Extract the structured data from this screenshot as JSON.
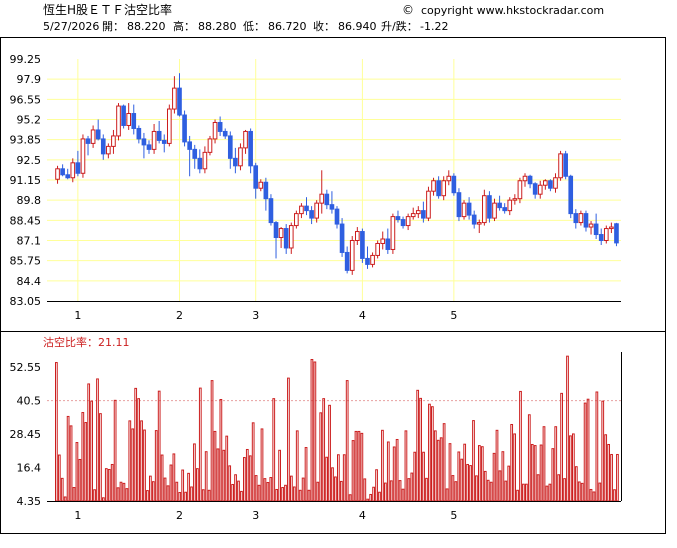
{
  "header": {
    "title": "恆生H股ＥＴＦ沽空比率",
    "copyright": "copyright www.hkstockradar.com",
    "date": "5/27/2026",
    "open_label": "開：",
    "open": "88.220",
    "high_label": "高：",
    "high": "88.280",
    "low_label": "低：",
    "low": "86.720",
    "close_label": "收：",
    "close": "86.940",
    "change_label": "升/跌：",
    "change": "-1.22"
  },
  "colors": {
    "up": "#cc1e1e",
    "down": "#2f5fe0",
    "grid": "#ffff99",
    "bar_stroke": "#cc1e1e",
    "ref_line": "#e8a0a0",
    "label_red": "#cc1e1e"
  },
  "chart_data": [
    {
      "type": "candlestick",
      "title": "",
      "xlabel": "",
      "ylabel": "",
      "ylim": [
        83.05,
        99.25
      ],
      "y_ticks": [
        "99.25",
        "97.9",
        "96.55",
        "95.2",
        "93.85",
        "92.5",
        "91.15",
        "89.8",
        "88.45",
        "87.1",
        "85.75",
        "84.4",
        "83.05"
      ],
      "x_ticks": [
        {
          "label": "1",
          "index": 4
        },
        {
          "label": "2",
          "index": 24
        },
        {
          "label": "3",
          "index": 39
        },
        {
          "label": "4",
          "index": 60
        },
        {
          "label": "5",
          "index": 78
        }
      ],
      "ohlc": [
        [
          91.2,
          92.1,
          90.9,
          91.9
        ],
        [
          91.9,
          92.2,
          91.4,
          91.5
        ],
        [
          91.5,
          91.9,
          91.2,
          91.3
        ],
        [
          91.3,
          92.6,
          91.0,
          92.3
        ],
        [
          92.3,
          93.1,
          91.4,
          91.6
        ],
        [
          91.6,
          94.2,
          91.3,
          93.9
        ],
        [
          93.9,
          94.1,
          92.8,
          93.6
        ],
        [
          93.6,
          94.8,
          93.3,
          94.5
        ],
        [
          94.5,
          95.2,
          93.8,
          93.9
        ],
        [
          93.9,
          94.2,
          92.5,
          92.9
        ],
        [
          92.9,
          93.6,
          92.6,
          93.4
        ],
        [
          93.4,
          94.5,
          92.9,
          94.1
        ],
        [
          94.1,
          96.3,
          93.8,
          96.1
        ],
        [
          96.1,
          96.2,
          94.6,
          94.8
        ],
        [
          94.8,
          96.3,
          94.5,
          95.6
        ],
        [
          95.6,
          96.2,
          94.2,
          94.6
        ],
        [
          94.6,
          94.8,
          93.6,
          93.9
        ],
        [
          93.9,
          94.3,
          92.6,
          93.5
        ],
        [
          93.5,
          93.8,
          92.9,
          93.2
        ],
        [
          93.2,
          94.9,
          92.9,
          94.4
        ],
        [
          94.4,
          95.1,
          93.6,
          93.8
        ],
        [
          93.8,
          94.2,
          93.0,
          93.6
        ],
        [
          93.6,
          96.2,
          93.4,
          95.9
        ],
        [
          95.9,
          98.1,
          95.6,
          97.3
        ],
        [
          97.3,
          98.3,
          95.4,
          95.5
        ],
        [
          95.5,
          95.8,
          93.4,
          93.7
        ],
        [
          93.7,
          94.1,
          91.4,
          93.2
        ],
        [
          93.2,
          93.5,
          91.9,
          92.6
        ],
        [
          92.6,
          93.2,
          91.6,
          91.9
        ],
        [
          91.9,
          93.4,
          91.6,
          93.0
        ],
        [
          93.0,
          94.1,
          92.8,
          93.9
        ],
        [
          93.9,
          95.2,
          93.6,
          95.0
        ],
        [
          95.0,
          95.4,
          94.1,
          94.4
        ],
        [
          94.4,
          94.6,
          93.9,
          94.1
        ],
        [
          94.1,
          94.4,
          91.9,
          92.6
        ],
        [
          92.6,
          93.3,
          91.6,
          92.1
        ],
        [
          92.1,
          93.6,
          91.8,
          93.3
        ],
        [
          93.3,
          94.5,
          92.9,
          94.4
        ],
        [
          94.4,
          94.6,
          91.6,
          92.1
        ],
        [
          92.1,
          92.3,
          89.9,
          90.6
        ],
        [
          90.6,
          91.2,
          90.4,
          91.0
        ],
        [
          91.0,
          91.3,
          89.1,
          89.9
        ],
        [
          89.9,
          90.2,
          88.1,
          88.3
        ],
        [
          88.3,
          88.4,
          85.9,
          87.3
        ],
        [
          87.3,
          88.0,
          86.6,
          87.9
        ],
        [
          87.9,
          88.2,
          86.2,
          86.6
        ],
        [
          86.6,
          88.3,
          86.2,
          88.1
        ],
        [
          88.1,
          89.1,
          87.9,
          88.9
        ],
        [
          88.9,
          89.6,
          88.6,
          89.4
        ],
        [
          89.4,
          90.0,
          88.8,
          89.1
        ],
        [
          89.1,
          89.4,
          88.2,
          88.6
        ],
        [
          88.6,
          89.8,
          88.3,
          89.6
        ],
        [
          89.6,
          91.8,
          88.9,
          90.2
        ],
        [
          90.2,
          90.5,
          89.2,
          89.5
        ],
        [
          89.5,
          90.4,
          88.9,
          89.2
        ],
        [
          89.2,
          89.4,
          87.9,
          88.2
        ],
        [
          88.2,
          88.6,
          86.0,
          86.3
        ],
        [
          86.3,
          86.7,
          84.9,
          85.1
        ],
        [
          85.1,
          87.4,
          84.8,
          87.1
        ],
        [
          87.1,
          88.0,
          86.8,
          87.7
        ],
        [
          87.7,
          87.9,
          85.6,
          85.9
        ],
        [
          85.9,
          86.7,
          85.2,
          85.5
        ],
        [
          85.5,
          86.3,
          85.3,
          86.1
        ],
        [
          86.1,
          87.1,
          85.9,
          86.9
        ],
        [
          86.9,
          87.7,
          86.5,
          87.2
        ],
        [
          87.2,
          87.9,
          86.2,
          86.5
        ],
        [
          86.5,
          88.9,
          86.2,
          88.7
        ],
        [
          88.7,
          89.1,
          88.3,
          88.5
        ],
        [
          88.5,
          88.7,
          87.9,
          88.1
        ],
        [
          88.1,
          88.9,
          87.8,
          88.7
        ],
        [
          88.7,
          89.3,
          88.5,
          88.9
        ],
        [
          88.9,
          89.4,
          88.6,
          89.1
        ],
        [
          89.1,
          89.7,
          88.3,
          88.6
        ],
        [
          88.6,
          90.7,
          88.4,
          90.4
        ],
        [
          90.4,
          91.3,
          90.1,
          91.1
        ],
        [
          91.1,
          91.4,
          89.9,
          90.1
        ],
        [
          90.1,
          91.4,
          89.8,
          91.1
        ],
        [
          91.1,
          91.8,
          90.8,
          91.4
        ],
        [
          91.4,
          91.6,
          90.1,
          90.3
        ],
        [
          90.3,
          90.6,
          88.4,
          88.7
        ],
        [
          88.7,
          89.8,
          88.5,
          89.6
        ],
        [
          89.6,
          90.0,
          88.5,
          88.8
        ],
        [
          88.8,
          89.1,
          87.9,
          88.2
        ],
        [
          88.2,
          88.5,
          87.6,
          88.3
        ],
        [
          88.3,
          90.5,
          88.1,
          90.1
        ],
        [
          90.1,
          90.4,
          88.3,
          88.6
        ],
        [
          88.6,
          89.9,
          88.4,
          89.6
        ],
        [
          89.6,
          90.1,
          89.1,
          89.3
        ],
        [
          89.3,
          89.6,
          88.9,
          89.1
        ],
        [
          89.1,
          90.0,
          88.8,
          89.8
        ],
        [
          89.8,
          90.2,
          89.5,
          89.9
        ],
        [
          89.9,
          91.3,
          89.6,
          91.1
        ],
        [
          91.1,
          91.6,
          90.7,
          91.4
        ],
        [
          91.4,
          91.5,
          90.6,
          90.9
        ],
        [
          90.9,
          91.0,
          89.9,
          90.2
        ],
        [
          90.2,
          91.1,
          89.9,
          90.8
        ],
        [
          90.8,
          91.2,
          90.5,
          91.1
        ],
        [
          91.1,
          91.2,
          90.4,
          90.6
        ],
        [
          90.6,
          91.6,
          90.3,
          91.3
        ],
        [
          91.3,
          93.1,
          91.1,
          92.9
        ],
        [
          92.9,
          93.1,
          91.2,
          91.4
        ],
        [
          91.4,
          91.5,
          88.6,
          88.9
        ],
        [
          88.9,
          89.2,
          87.9,
          88.3
        ],
        [
          88.3,
          89.1,
          88.1,
          88.9
        ],
        [
          88.9,
          89.1,
          87.7,
          88.0
        ],
        [
          88.0,
          88.4,
          87.5,
          88.2
        ],
        [
          88.2,
          88.9,
          87.2,
          87.5
        ],
        [
          87.5,
          87.9,
          86.8,
          87.1
        ],
        [
          87.1,
          88.1,
          86.9,
          87.9
        ],
        [
          87.9,
          88.3,
          87.6,
          88.0
        ],
        [
          88.22,
          88.28,
          86.72,
          86.94
        ]
      ]
    },
    {
      "type": "bar",
      "title": "沽空比率",
      "label": "沽空比率：",
      "last_value": "21.11",
      "ylim": [
        4.35,
        58.0
      ],
      "reference_line": 40.5,
      "y_ticks": [
        "52.55",
        "40.5",
        "28.45",
        "16.4",
        "4.35"
      ],
      "x_ticks": [
        {
          "label": "1",
          "index": 4
        },
        {
          "label": "2",
          "index": 24
        },
        {
          "label": "3",
          "index": 39
        },
        {
          "label": "4",
          "index": 60
        },
        {
          "label": "5",
          "index": 78
        }
      ],
      "values": [
        54.2,
        20.9,
        12.5,
        5.8,
        34.8,
        31.4,
        9.2,
        25.4,
        19.3,
        36.2,
        32.6,
        46.5,
        40.3,
        8.4,
        48.3,
        35.8,
        5.5,
        16.0,
        15.7,
        17.5,
        40.6,
        9.1,
        11.1,
        10.7,
        8.8,
        33.2,
        30.3,
        44.9,
        41.2,
        33.2,
        29.9,
        8.1,
        13.3,
        11.3,
        29.7,
        43.9,
        20.9,
        12.6,
        9.8,
        17.3,
        21.3,
        11.1,
        7.4,
        15.5,
        7.5,
        14.3,
        9.4,
        24.9,
        16.0,
        45.0,
        8.4,
        22.1,
        8.2,
        47.7,
        29.4,
        23.1,
        40.9,
        22.6,
        27.7,
        17.0,
        10.3,
        13.8,
        11.5,
        7.8,
        20.0,
        22.9,
        20.6,
        32.5,
        13.5,
        10.0,
        30.3,
        12.4,
        11.0,
        12.8,
        41.2,
        8.5,
        22.6,
        9.2,
        10.0,
        48.6,
        13.3,
        9.4,
        29.6,
        8.2,
        12.6,
        23.6,
        8.2,
        55.3,
        54.4,
        11.1,
        36.1,
        41.2,
        20.1,
        38.8,
        16.3,
        13.0,
        21.0,
        11.4,
        21.0,
        47.7,
        6.6,
        26.1,
        29.4,
        29.4,
        28.7,
        12.3,
        5.0,
        6.7,
        9.3,
        15.6,
        7.5,
        29.8,
        10.8,
        25.6,
        11.6,
        23.8,
        26.5,
        11.7,
        8.6,
        29.6,
        12.4,
        14.4,
        21.9,
        44.2,
        41.3,
        21.9,
        12.5,
        39.2,
        38.3,
        29.6,
        26.2,
        27.1,
        32.2,
        8.7,
        25.0,
        13.5,
        11.3,
        22.0,
        19.4,
        24.8,
        17.5,
        17.1,
        33.3,
        13.4,
        24.3,
        23.9,
        15.0,
        11.8,
        11.1,
        21.5,
        29.8,
        15.2,
        22.1,
        11.5,
        16.9,
        31.9,
        28.5,
        8.2,
        43.8,
        10.4,
        10.4,
        35.4,
        24.7,
        24.3,
        13.8,
        24.5,
        31.1,
        9.7,
        10.4,
        23.2,
        31.1,
        13.8,
        43.1,
        12.4,
        56.5,
        27.8,
        28.5,
        16.7,
        11.2,
        10.7,
        39.6,
        41.0,
        8.5,
        7.6,
        43.6,
        10.8,
        40.3,
        28.2,
        24.7,
        21.1,
        8.4,
        21.1
      ]
    }
  ]
}
